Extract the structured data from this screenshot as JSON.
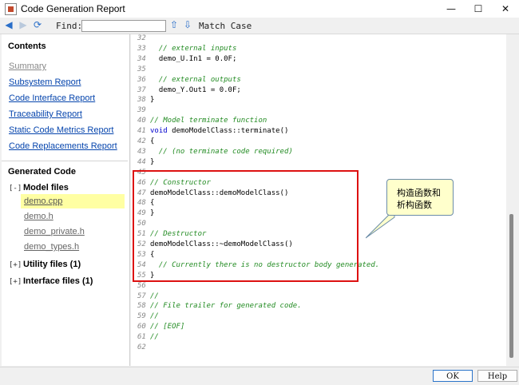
{
  "window": {
    "title": "Code Generation Report",
    "minimize": "—",
    "maximize": "☐",
    "close": "✕"
  },
  "toolbar": {
    "back": "◀",
    "forward": "▶",
    "refresh": "⟳",
    "find_label": "Find:",
    "find_value": "",
    "up": "⇧",
    "down": "⇩",
    "match_case": "Match Case"
  },
  "contents": {
    "title": "Contents",
    "links": [
      "Summary",
      "Subsystem Report",
      "Code Interface Report",
      "Traceability Report",
      "Static Code Metrics Report",
      "Code Replacements Report"
    ]
  },
  "generated": {
    "title": "Generated Code",
    "model_files": {
      "expander": "[-]",
      "label": "Model files",
      "files": [
        "demo.cpp",
        "demo.h",
        "demo_private.h",
        "demo_types.h"
      ]
    },
    "utility_files": {
      "expander": "[+]",
      "label": "Utility files (1)"
    },
    "interface_files": {
      "expander": "[+]",
      "label": "Interface files (1)"
    }
  },
  "code": [
    {
      "n": "32",
      "t": "",
      "c": "plain"
    },
    {
      "n": "33",
      "t": "  // external inputs",
      "c": "comment"
    },
    {
      "n": "34",
      "t": "  demo_U.In1 = 0.0F;",
      "c": "plain"
    },
    {
      "n": "35",
      "t": "",
      "c": "plain"
    },
    {
      "n": "36",
      "t": "  // external outputs",
      "c": "comment"
    },
    {
      "n": "37",
      "t": "  demo_Y.Out1 = 0.0F;",
      "c": "plain"
    },
    {
      "n": "38",
      "t": "}",
      "c": "plain"
    },
    {
      "n": "39",
      "t": "",
      "c": "plain"
    },
    {
      "n": "40",
      "t": "// Model terminate function",
      "c": "comment"
    },
    {
      "n": "41",
      "t": "void demoModelClass::terminate()",
      "c": "kw"
    },
    {
      "n": "42",
      "t": "{",
      "c": "plain"
    },
    {
      "n": "43",
      "t": "  // (no terminate code required)",
      "c": "comment"
    },
    {
      "n": "44",
      "t": "}",
      "c": "plain"
    },
    {
      "n": "45",
      "t": "",
      "c": "plain"
    },
    {
      "n": "46",
      "t": "// Constructor",
      "c": "comment"
    },
    {
      "n": "47",
      "t": "demoModelClass::demoModelClass()",
      "c": "plain"
    },
    {
      "n": "48",
      "t": "{",
      "c": "plain"
    },
    {
      "n": "49",
      "t": "}",
      "c": "plain"
    },
    {
      "n": "50",
      "t": "",
      "c": "plain"
    },
    {
      "n": "51",
      "t": "// Destructor",
      "c": "comment"
    },
    {
      "n": "52",
      "t": "demoModelClass::~demoModelClass()",
      "c": "plain"
    },
    {
      "n": "53",
      "t": "{",
      "c": "plain"
    },
    {
      "n": "54",
      "t": "  // Currently there is no destructor body generated.",
      "c": "comment"
    },
    {
      "n": "55",
      "t": "}",
      "c": "plain"
    },
    {
      "n": "56",
      "t": "",
      "c": "plain"
    },
    {
      "n": "57",
      "t": "//",
      "c": "comment"
    },
    {
      "n": "58",
      "t": "// File trailer for generated code.",
      "c": "comment"
    },
    {
      "n": "59",
      "t": "//",
      "c": "comment"
    },
    {
      "n": "60",
      "t": "// [EOF]",
      "c": "comment"
    },
    {
      "n": "61",
      "t": "//",
      "c": "comment"
    },
    {
      "n": "62",
      "t": "",
      "c": "plain"
    }
  ],
  "annotation": {
    "text": "构造函数和析构函数"
  },
  "buttons": {
    "ok": "OK",
    "help": "Help"
  },
  "colors": {
    "link": "#0645ad",
    "comment": "#228b22",
    "highlight_box": "#d11111",
    "callout_bg": "#ffffcc",
    "file_highlight": "#ffffa3"
  }
}
